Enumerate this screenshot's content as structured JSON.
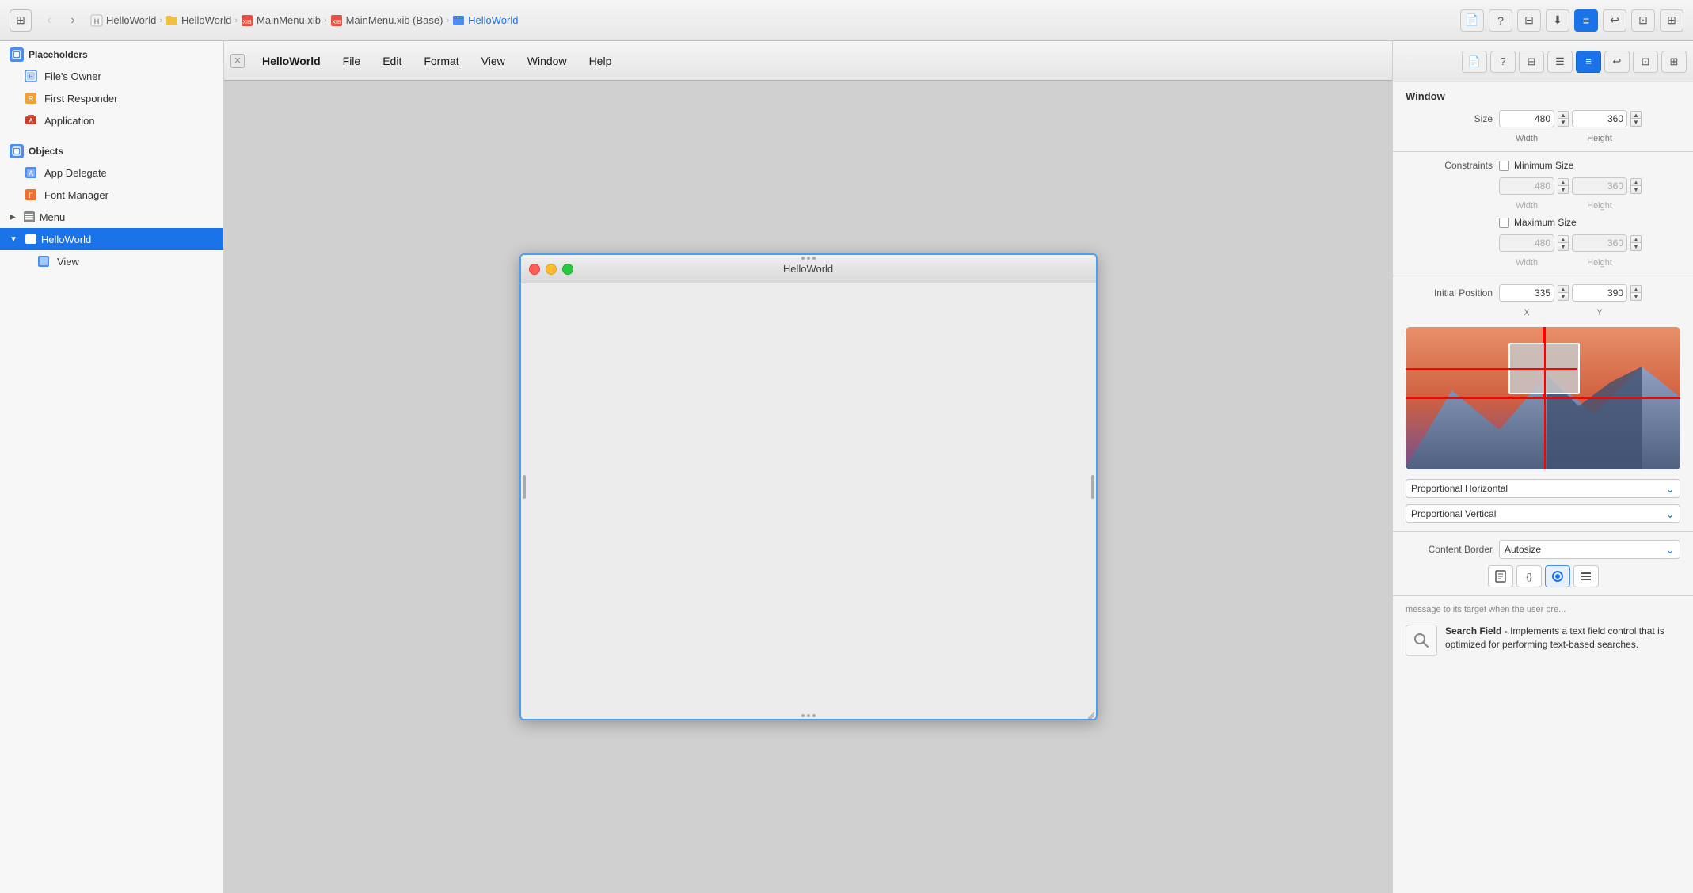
{
  "toolbar": {
    "grid_icon": "⊞",
    "back_label": "‹",
    "forward_label": "›",
    "breadcrumbs": [
      {
        "label": "HelloWorld",
        "icon": "📄",
        "type": "swift"
      },
      {
        "label": "HelloWorld",
        "icon": "📁",
        "type": "folder"
      },
      {
        "label": "MainMenu.xib",
        "icon": "🔴",
        "type": "xib"
      },
      {
        "label": "MainMenu.xib (Base)",
        "icon": "🔴",
        "type": "xib"
      },
      {
        "label": "HelloWorld",
        "icon": "🪟",
        "type": "window"
      }
    ],
    "right_buttons": [
      "📄",
      "?",
      "⊟",
      "⬇",
      "≡",
      "↩",
      "⊡",
      "⊞"
    ]
  },
  "sidebar": {
    "placeholders_label": "Placeholders",
    "placeholders_icon": "cube",
    "items_placeholders": [
      {
        "label": "File's Owner",
        "icon": "file-icon"
      },
      {
        "label": "First Responder",
        "icon": "first-responder-icon"
      },
      {
        "label": "Application",
        "icon": "app-icon"
      }
    ],
    "objects_label": "Objects",
    "objects_icon": "cube",
    "items_objects": [
      {
        "label": "App Delegate",
        "icon": "cube-blue"
      },
      {
        "label": "Font Manager",
        "icon": "cube-orange"
      },
      {
        "label": "Menu",
        "icon": "menu-icon",
        "expandable": true
      }
    ],
    "helloworld_label": "HelloWorld",
    "helloworld_icon": "window-icon",
    "view_label": "View",
    "view_icon": "view-icon"
  },
  "menubar": {
    "app_name": "HelloWorld",
    "items": [
      "File",
      "Edit",
      "Format",
      "View",
      "Window",
      "Help"
    ]
  },
  "canvas_window": {
    "title": "HelloWorld",
    "traffic_lights": [
      "red",
      "yellow",
      "green"
    ]
  },
  "inspector": {
    "section_title": "Window",
    "size_label": "Size",
    "width_value": "480",
    "height_value": "360",
    "width_label": "Width",
    "height_label": "Height",
    "constraints_label": "Constraints",
    "minimum_size_label": "Minimum Size",
    "min_width_value": "480",
    "min_height_value": "360",
    "maximum_size_label": "Maximum Size",
    "max_width_value": "480",
    "max_height_value": "360",
    "initial_position_label": "Initial Position",
    "x_value": "335",
    "y_value": "390",
    "x_label": "X",
    "y_label": "Y",
    "horizontal_dropdown": "Proportional Horizontal",
    "vertical_dropdown": "Proportional Vertical",
    "content_border_label": "Content Border",
    "content_border_value": "Autosize",
    "bottom_desc_text": "message to its target when the user pre...",
    "search_title": "Search Field",
    "search_desc": "Implements a text field control that is optimized for performing text-based searches."
  }
}
